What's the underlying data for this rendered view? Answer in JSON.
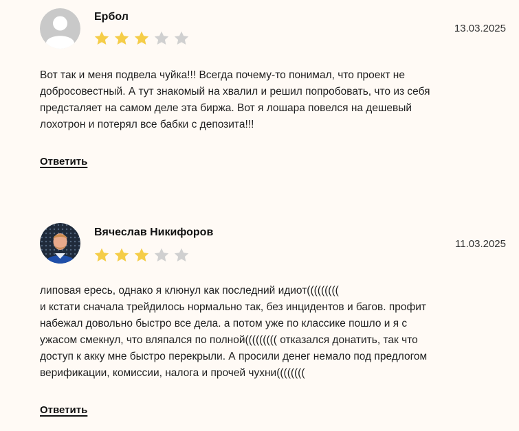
{
  "colors": {
    "star_filled": "#f5cd48",
    "star_empty": "#d0d0d0",
    "background": "#fffaf5"
  },
  "reviews": [
    {
      "author": "Ербол",
      "date": "13.03.2025",
      "rating": 3,
      "max_rating": 5,
      "avatar": "default-user-avatar",
      "text": "Вот так и меня подвела чуйка!!! Всегда почему-то понимал, что проект не\nдобросовестный. А тут знакомый на хвалил и решил попробовать, что из себя\nпредсталяет на самом деле эта биржа. Вот я лошара повелся на дешевый\nлохотрон и потерял все бабки с депозита!!!",
      "reply_label": "Ответить"
    },
    {
      "author": "Вячеслав Никифоров",
      "date": "11.03.2025",
      "rating": 3,
      "max_rating": 5,
      "avatar": "user-photo-avatar",
      "text": "липовая ересь, однако я клюнул как последний идиот(((((((((\nи кстати сначала трейдилось нормально так, без инцидентов и багов. профит\nнабежал довольно быстро все дела. а потом уже по классике пошло и я с\nужасом смекнул, что вляпался по полной((((((((( отказался донатить, так что\nдоступ к акку мне быстро перекрыли. А просили денег немало под предлогом\nверификации, комиссии, налога и прочей чухни((((((((",
      "reply_label": "Ответить"
    }
  ]
}
